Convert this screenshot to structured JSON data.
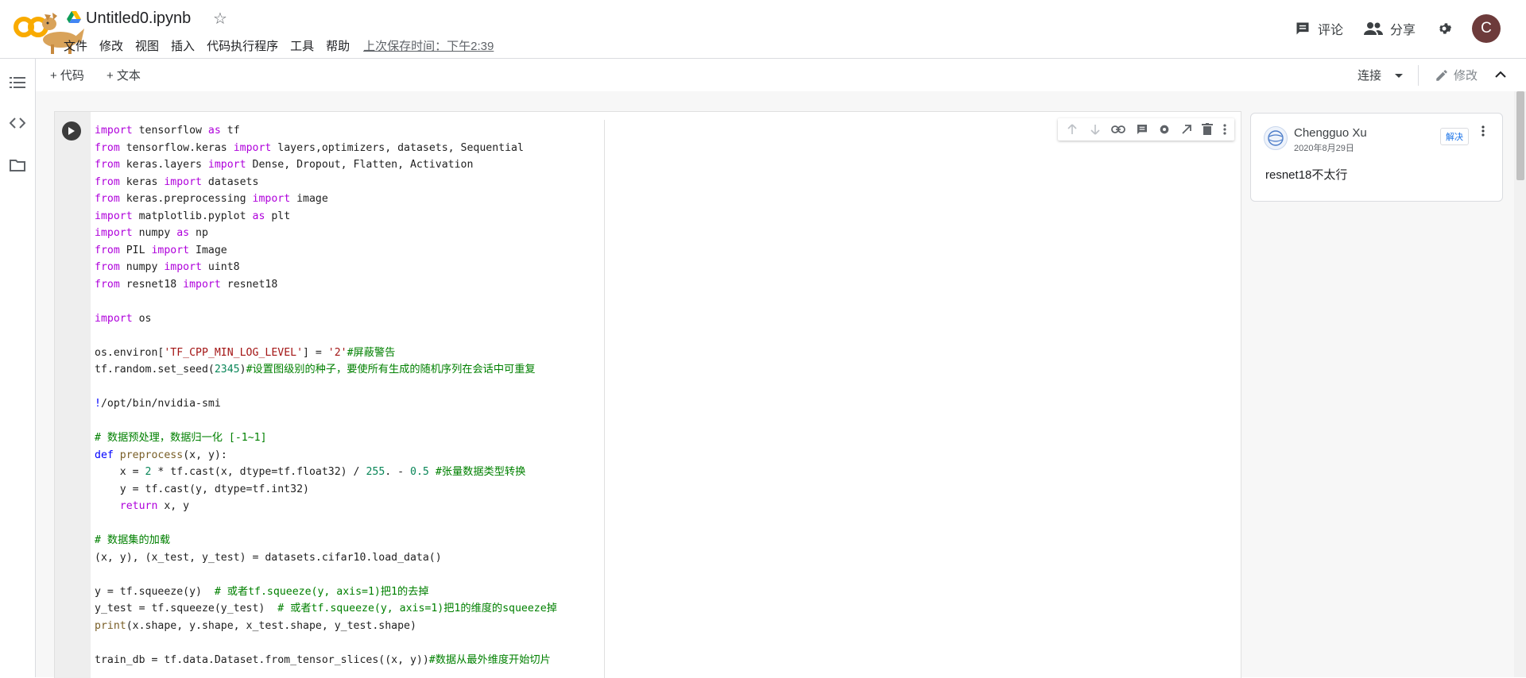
{
  "header": {
    "notebook_title": "Untitled0.ipynb",
    "menu": [
      "文件",
      "修改",
      "视图",
      "插入",
      "代码执行程序",
      "工具",
      "帮助"
    ],
    "last_saved": "上次保存时间：下午2:39",
    "comment_label": "评论",
    "share_label": "分享",
    "avatar_letter": "C"
  },
  "toolbar": {
    "add_code": "+ 代码",
    "add_text": "+ 文本",
    "connect_label": "连接",
    "edit_label": "修改"
  },
  "sidebar": {
    "items": [
      "table-of-contents-icon",
      "code-snippets-icon",
      "files-icon"
    ]
  },
  "cell_toolbar": {
    "icons": [
      "move-up-icon",
      "move-down-icon",
      "link-icon",
      "comment-icon",
      "settings-icon",
      "mirror-cell-icon",
      "delete-icon",
      "more-icon"
    ]
  },
  "comment": {
    "author": "Chengguo Xu",
    "date": "2020年8月29日",
    "resolve_label": "解决",
    "text": "resnet18不太行"
  },
  "code_lines": [
    "import tensorflow as tf",
    "from tensorflow.keras import layers,optimizers, datasets, Sequential",
    "from keras.layers import Dense, Dropout, Flatten, Activation",
    "from keras import datasets",
    "from keras.preprocessing import image",
    "import matplotlib.pyplot as plt",
    "import numpy as np",
    "from PIL import Image",
    "from numpy import uint8",
    "from resnet18 import resnet18",
    "",
    "import os",
    "",
    "os.environ['TF_CPP_MIN_LOG_LEVEL'] = '2'#屏蔽警告",
    "tf.random.set_seed(2345)#设置图级别的种子，要使所有生成的随机序列在会话中可重复",
    "",
    "!/opt/bin/nvidia-smi",
    "",
    "# 数据预处理，数据归一化 [-1~1]",
    "def preprocess(x, y):",
    "    x = 2 * tf.cast(x, dtype=tf.float32) / 255. - 0.5 #张量数据类型转换",
    "    y = tf.cast(y, dtype=tf.int32)",
    "    return x, y",
    "",
    "# 数据集的加载",
    "(x, y), (x_test, y_test) = datasets.cifar10.load_data()",
    "",
    "y = tf.squeeze(y)  # 或者tf.squeeze(y, axis=1)把1的去掉",
    "y_test = tf.squeeze(y_test)  # 或者tf.squeeze(y, axis=1)把1的维度的squeeze掉",
    "print(x.shape, y.shape, x_test.shape, y_test.shape)",
    "",
    "train_db = tf.data.Dataset.from_tensor_slices((x, y))#数据从最外维度开始切片"
  ]
}
